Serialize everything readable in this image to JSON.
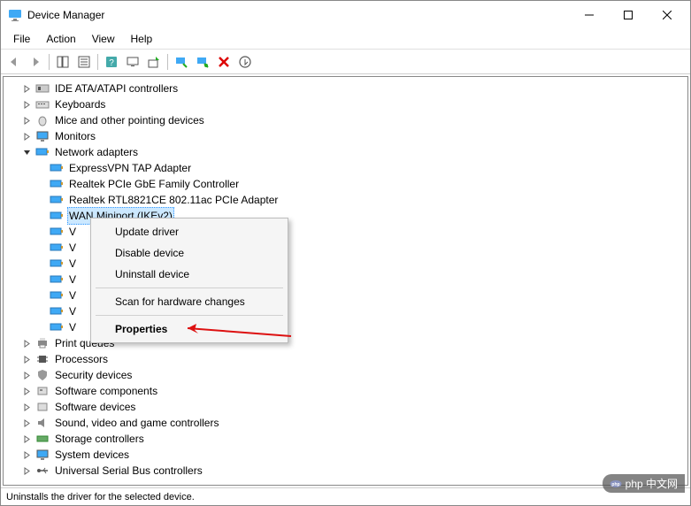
{
  "window": {
    "title": "Device Manager"
  },
  "menu": {
    "file": "File",
    "action": "Action",
    "view": "View",
    "help": "Help"
  },
  "tree": {
    "ide": "IDE ATA/ATAPI controllers",
    "keyboards": "Keyboards",
    "mice": "Mice and other pointing devices",
    "monitors": "Monitors",
    "network": "Network adapters",
    "net_items": {
      "n0": "ExpressVPN TAP Adapter",
      "n1": "Realtek PCIe GbE Family Controller",
      "n2": "Realtek RTL8821CE 802.11ac PCIe Adapter",
      "n3": "WAN Miniport (IKEv2)",
      "n4": "V",
      "n5": "V",
      "n6": "V",
      "n7": "V",
      "n8": "V",
      "n9": "V",
      "n10": "V"
    },
    "printqueues": "Print queues",
    "processors": "Processors",
    "securitydevices": "Security devices",
    "softwarecomponents": "Software components",
    "softwaredevices": "Software devices",
    "sound": "Sound, video and game controllers",
    "storage": "Storage controllers",
    "systemdevices": "System devices",
    "usb": "Universal Serial Bus controllers"
  },
  "contextmenu": {
    "update": "Update driver",
    "disable": "Disable device",
    "uninstall": "Uninstall device",
    "scan": "Scan for hardware changes",
    "properties": "Properties"
  },
  "status": {
    "text": "Uninstalls the driver for the selected device."
  },
  "watermark": {
    "text": "php 中文网"
  }
}
